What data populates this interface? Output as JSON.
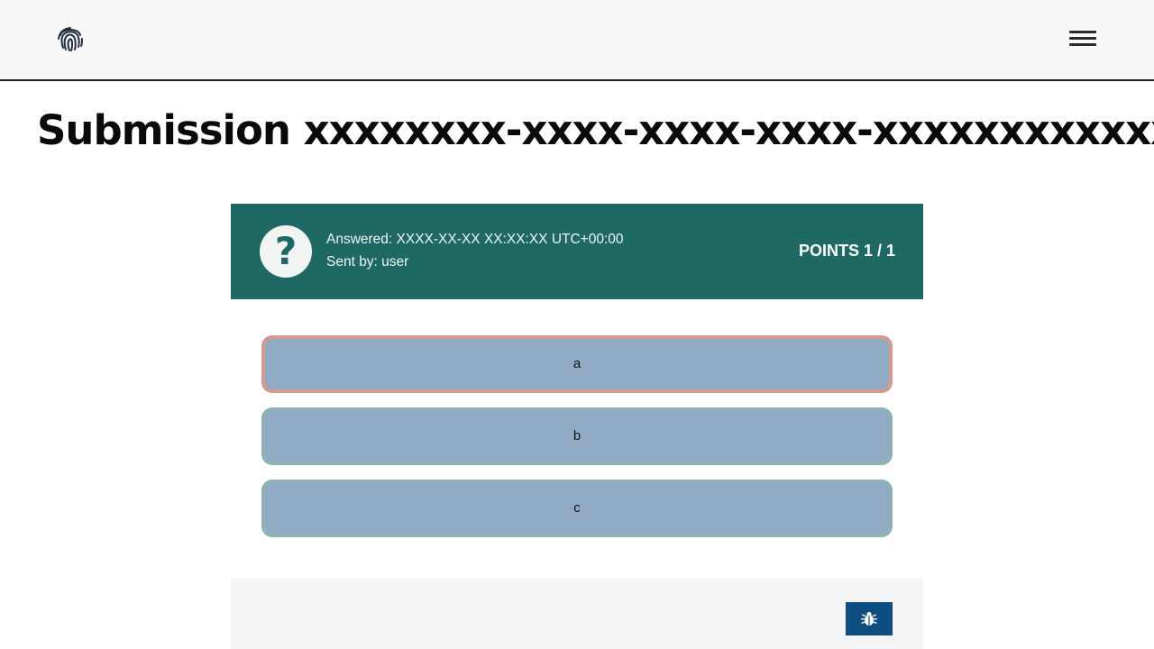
{
  "header": {
    "logo_icon": "fingerprint-icon",
    "menu_icon": "hamburger-menu-icon"
  },
  "page": {
    "title": "Submission xxxxxxxx-xxxx-xxxx-xxxx-xxxxxxxxxxxx"
  },
  "submission": {
    "status_icon": "question-mark-icon",
    "status_glyph": "?",
    "answered": "Answered: XXXX-XX-XX XX:XX:XX UTC+00:00",
    "sent_by": "Sent by: user",
    "points": "POINTS 1 / 1",
    "accent_color": "#1f6965"
  },
  "options": [
    {
      "label": "a",
      "selected": true
    },
    {
      "label": "b",
      "selected": false
    },
    {
      "label": "c",
      "selected": false
    }
  ],
  "footer": {
    "bug_icon": "bug-report-icon",
    "button_color": "#0e4e80"
  }
}
